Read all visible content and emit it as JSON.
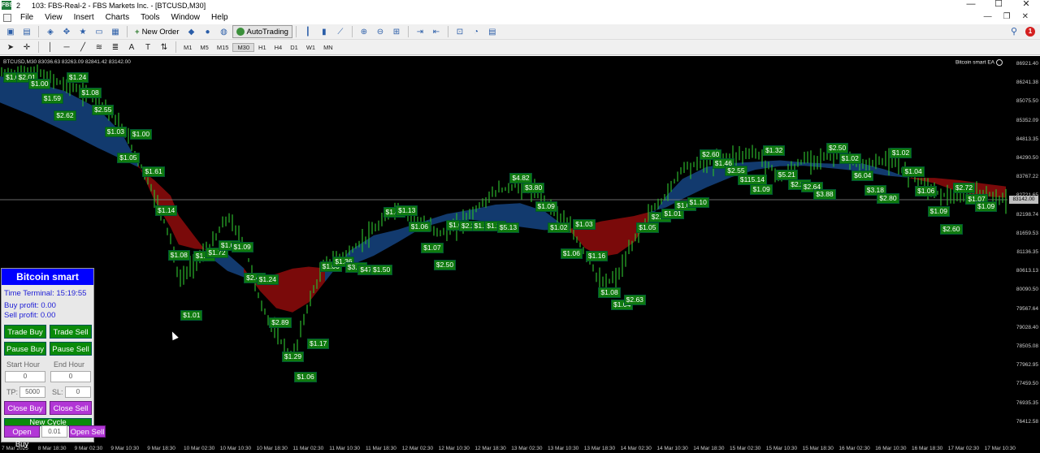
{
  "window": {
    "tab_number": "2",
    "title": "103: FBS-Real-2 - FBS Markets Inc. - [BTCUSD,M30]",
    "logo_text": "FBS"
  },
  "menu": [
    "File",
    "View",
    "Insert",
    "Charts",
    "Tools",
    "Window",
    "Help"
  ],
  "toolbar": {
    "new_order_label": "New Order",
    "autotrading_label": "AutoTrading",
    "timeframes": [
      "M1",
      "M5",
      "M15",
      "M30",
      "H1",
      "H4",
      "D1",
      "W1",
      "MN"
    ],
    "active_timeframe": "M30",
    "notification_count": "1"
  },
  "chart": {
    "symbol_info": "BTCUSD,M30  83036.63 83263.09 82841.42 83142.00",
    "ea_name": "Bitcoin smart EA",
    "current_price": "83142.00",
    "price_axis": [
      "86921.40",
      "86241.38",
      "85075.50",
      "85352.09",
      "84813.35",
      "84290.50",
      "83767.22",
      "82721.65",
      "82198.74",
      "81659.53",
      "81136.35",
      "80613.13",
      "80090.50",
      "79567.64",
      "79028.40",
      "78505.08",
      "77962.95",
      "77459.50",
      "76935.35",
      "76412.58"
    ],
    "time_axis": [
      "7 Mar 2025",
      "8 Mar 18:30",
      "9 Mar 02:30",
      "9 Mar 10:30",
      "9 Mar 18:30",
      "10 Mar 02:30",
      "10 Mar 10:30",
      "10 Mar 18:30",
      "11 Mar 02:30",
      "11 Mar 10:30",
      "11 Mar 18:30",
      "12 Mar 02:30",
      "12 Mar 10:30",
      "12 Mar 18:30",
      "13 Mar 02:30",
      "13 Mar 10:30",
      "13 Mar 18:30",
      "14 Mar 02:30",
      "14 Mar 10:30",
      "14 Mar 18:30",
      "15 Mar 02:30",
      "15 Mar 10:30",
      "15 Mar 18:30",
      "16 Mar 02:30",
      "16 Mar 10:30",
      "16 Mar 18:30",
      "17 Mar 02:30",
      "17 Mar 10:30"
    ],
    "profit_labels": [
      "$1.01",
      "$2.01",
      "$1.00",
      "$1.59",
      "$2.62",
      "$1.24",
      "$1.08",
      "$2.55",
      "$1.03",
      "$1.05",
      "$1.00",
      "$1.61",
      "$1.14",
      "$1.08",
      "$1.01",
      "$1.06",
      "$1.72",
      "$1.00",
      "$1.09",
      "$2.47",
      "$1.24",
      "$2.89",
      "$1.29",
      "$1.06",
      "$1.17",
      "$1.00",
      "$1.36",
      "$3.85",
      "$47.27",
      "$1.50",
      "$1.45",
      "$1.13",
      "$1.06",
      "$1.07",
      "$2.50",
      "$1.04",
      "$2.29",
      "$1.25",
      "$1.17",
      "$5.13",
      "$4.82",
      "$3.80",
      "$1.09",
      "$1.02",
      "$1.06",
      "$1.03",
      "$1.16",
      "$1.08",
      "$1.04",
      "$2.63",
      "$1.05",
      "$2.80",
      "$1.01",
      "$1.05",
      "$1.10",
      "$2.60",
      "$1.46",
      "$2.55",
      "$115.14",
      "$1.09",
      "$1.32",
      "$5.21",
      "$2.26",
      "$2.64",
      "$3.88",
      "$2.50",
      "$1.02",
      "$6.04",
      "$3.18",
      "$2.80",
      "$1.02",
      "$1.04",
      "$1.06",
      "$1.09",
      "$2.60",
      "$2.72",
      "$1.07",
      "$1.09"
    ]
  },
  "panel": {
    "title": "Bitcoin smart",
    "time_terminal": "Time Terminal: 15:19:55",
    "buy_profit": "Buy profit: 0.00",
    "sell_profit": "Sell profit: 0.00",
    "trade_buy": "Trade Buy",
    "trade_sell": "Trade Sell",
    "pause_buy": "Pause Buy",
    "pause_sell": "Pause Sell",
    "start_hour_label": "Start Hour",
    "end_hour_label": "End Hour",
    "start_hour_value": "0",
    "end_hour_value": "0",
    "tp_label": "TP:",
    "tp_value": "5000",
    "sl_label": "SL:",
    "sl_value": "0",
    "close_buy": "Close Buy",
    "close_sell": "Close Sell",
    "new_cycle": "New Cycle",
    "open_buy": "Open Buy",
    "lot_value": "0.01",
    "open_sell": "Open Sell"
  },
  "colors": {
    "bearish_cloud": "#7a0a0a",
    "bullish_cloud": "#123a6e",
    "candle": "#2bb52b",
    "label_bg": "#0f7a0f",
    "panel_title": "#0000ff"
  }
}
